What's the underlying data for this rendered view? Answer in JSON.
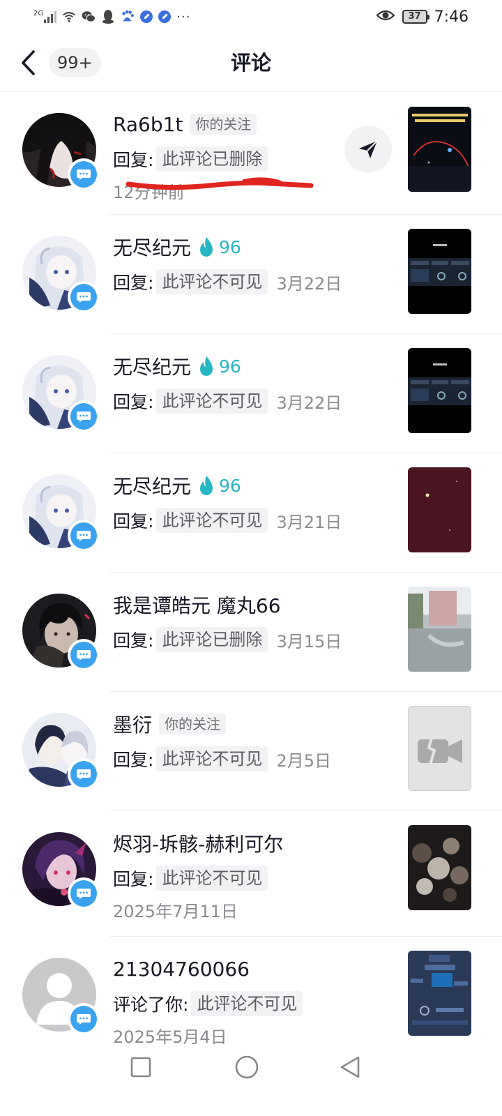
{
  "status_bar": {
    "network": "2G",
    "time": "7:46",
    "battery": "37",
    "icons": [
      "signal-icon",
      "wifi-icon",
      "wechat-icon",
      "qq-icon",
      "baidu-icon",
      "app-icon",
      "app-icon",
      "more-icon",
      "eye-icon",
      "battery-icon"
    ],
    "more": "···"
  },
  "header": {
    "title": "评论",
    "unread_count": "99+"
  },
  "comments": [
    {
      "username": "Ra6b1t",
      "tag": "你的关注",
      "reply_prefix": "回复:",
      "reply_text": "此评论已删除",
      "time": "12分钟前",
      "has_send_button": true
    },
    {
      "username": "无尽纪元",
      "fire_count": "96",
      "reply_prefix": "回复:",
      "reply_text": "此评论不可见",
      "date": "3月22日"
    },
    {
      "username": "无尽纪元",
      "fire_count": "96",
      "reply_prefix": "回复:",
      "reply_text": "此评论不可见",
      "date": "3月22日"
    },
    {
      "username": "无尽纪元",
      "fire_count": "96",
      "reply_prefix": "回复:",
      "reply_text": "此评论不可见",
      "date": "3月21日"
    },
    {
      "username": "我是谭皓元 魔丸66",
      "reply_prefix": "回复:",
      "reply_text": "此评论已删除",
      "date": "3月15日"
    },
    {
      "username": "墨衍",
      "tag": "你的关注",
      "reply_prefix": "回复:",
      "reply_text": "此评论不可见",
      "date": "2月5日"
    },
    {
      "username": "烬羽-坼骸-赫利可尔",
      "reply_prefix": "回复:",
      "reply_text": "此评论不可见",
      "time": "2025年7月11日"
    },
    {
      "username": "21304760066",
      "reply_prefix": "评论了你:",
      "reply_text": "此评论不可见",
      "time": "2025年5月4日"
    }
  ],
  "colors": {
    "accent_fire": "#26b6c4",
    "message_badge": "#3aa3f0",
    "scribble": "#e0251f"
  }
}
